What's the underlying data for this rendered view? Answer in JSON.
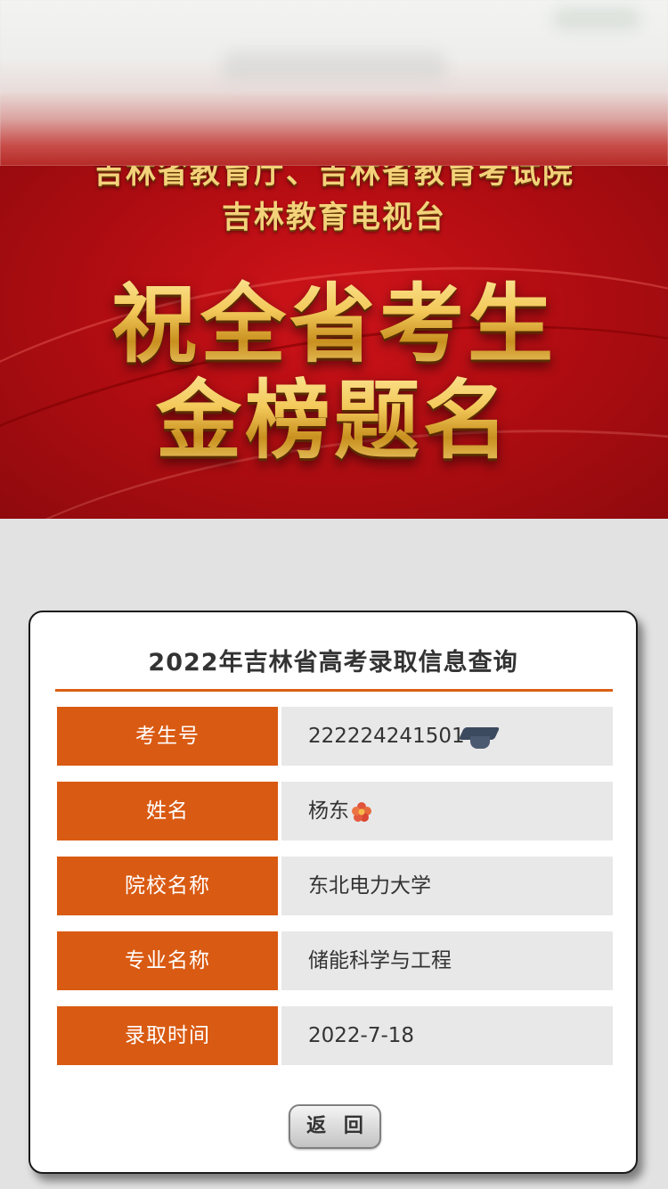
{
  "banner": {
    "org_line_1": "吉林省教育厅、吉林省教育考试院",
    "org_line_2": "吉林教育电视台",
    "headline_1": "祝全省考生",
    "headline_2": "金榜题名"
  },
  "card": {
    "title": "2022年吉林省高考录取信息查询",
    "rows": [
      {
        "label": "考生号",
        "value": "222224241501"
      },
      {
        "label": "姓名",
        "value": "杨东"
      },
      {
        "label": "院校名称",
        "value": "东北电力大学"
      },
      {
        "label": "专业名称",
        "value": "储能科学与工程"
      },
      {
        "label": "录取时间",
        "value": "2022-7-18"
      }
    ],
    "back_label": "返 回"
  },
  "colors": {
    "accent": "#d95a12",
    "banner_red": "#b30d12",
    "gold": "#f3c95a"
  },
  "icons": {
    "student_id_mask": "graduation-cap-icon",
    "name_mask": "flower-icon"
  }
}
